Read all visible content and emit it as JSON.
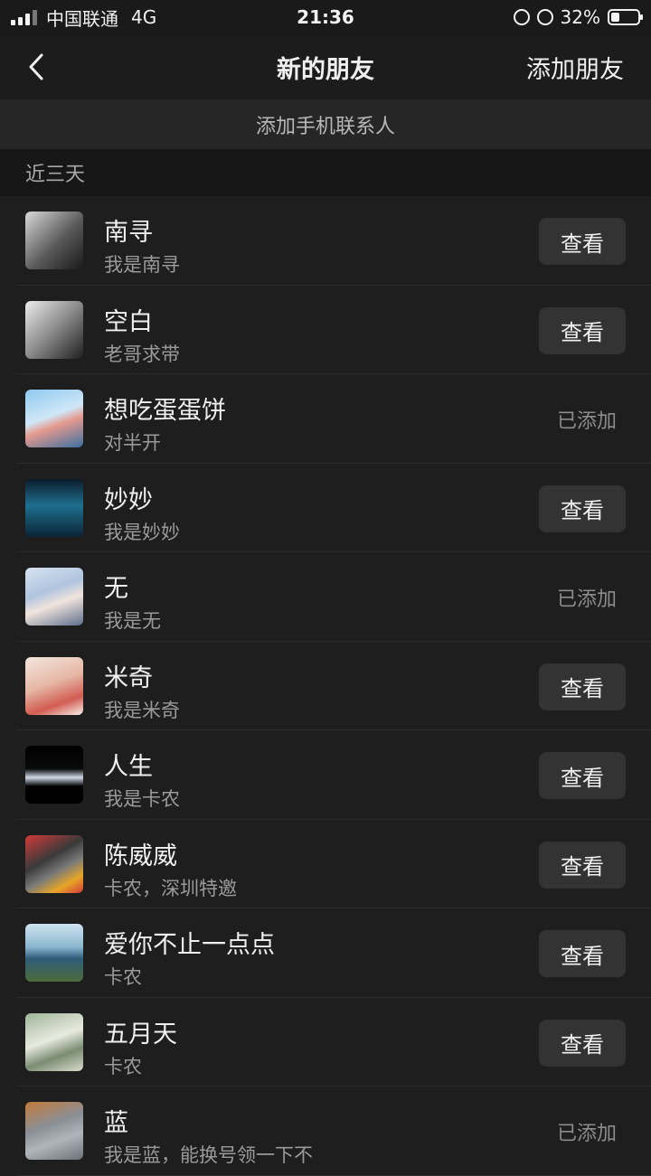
{
  "status_bar": {
    "carrier": "中国联通",
    "network": "4G",
    "time": "21:36",
    "battery": "32%",
    "battery_level": 0.32
  },
  "nav": {
    "title": "新的朋友",
    "action_label": "添加朋友",
    "back_icon": "chevron-left-icon"
  },
  "add_contacts_label": "添加手机联系人",
  "section_label": "近三天",
  "colors": {
    "background": "#1e1e1e",
    "button_bg": "#333333",
    "secondary_text": "#9a9a9a"
  },
  "friends": [
    {
      "name": "南寻",
      "message": "我是南寻",
      "status": "view",
      "view_label": "查看",
      "added_label": ""
    },
    {
      "name": "空白",
      "message": "老哥求带",
      "status": "view",
      "view_label": "查看",
      "added_label": ""
    },
    {
      "name": "想吃蛋蛋饼",
      "message": "对半开",
      "status": "added",
      "view_label": "",
      "added_label": "已添加"
    },
    {
      "name": "妙妙",
      "message": "我是妙妙",
      "status": "view",
      "view_label": "查看",
      "added_label": ""
    },
    {
      "name": "无",
      "message": "我是无",
      "status": "added",
      "view_label": "",
      "added_label": "已添加"
    },
    {
      "name": "米奇",
      "message": "我是米奇",
      "status": "view",
      "view_label": "查看",
      "added_label": ""
    },
    {
      "name": "人生",
      "message": "我是卡农",
      "status": "view",
      "view_label": "查看",
      "added_label": ""
    },
    {
      "name": "陈威威",
      "message": "卡农，深圳特邀",
      "status": "view",
      "view_label": "查看",
      "added_label": ""
    },
    {
      "name": "爱你不止一点点",
      "message": "卡农",
      "status": "view",
      "view_label": "查看",
      "added_label": ""
    },
    {
      "name": "五月天",
      "message": "卡农",
      "status": "view",
      "view_label": "查看",
      "added_label": ""
    },
    {
      "name": "蓝",
      "message": "我是蓝，能换号领一下不",
      "status": "added",
      "view_label": "",
      "added_label": "已添加"
    }
  ]
}
